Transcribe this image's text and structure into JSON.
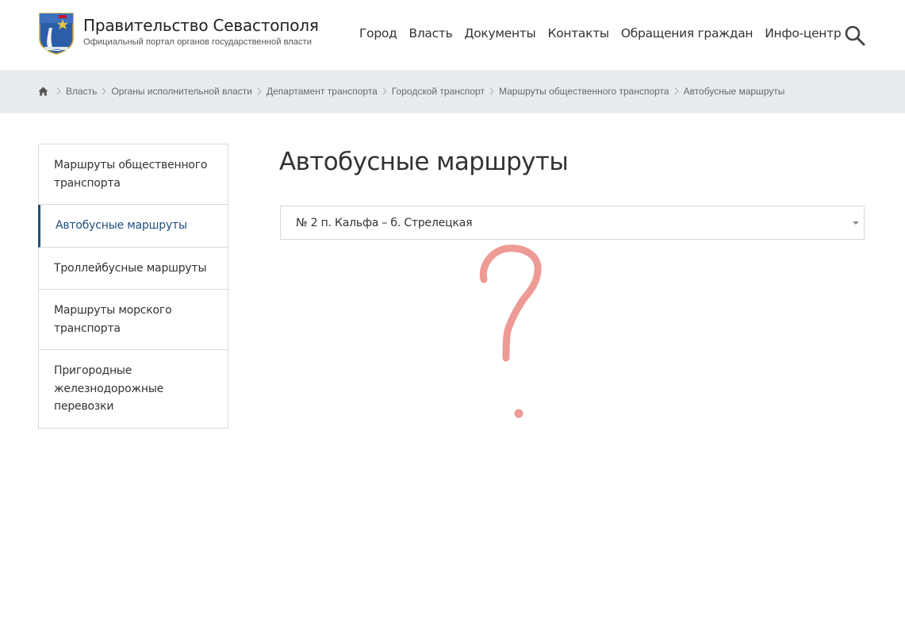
{
  "header": {
    "title": "Правительство Севастополя",
    "subtitle": "Официальный портал органов государственной власти",
    "nav": [
      {
        "label": "Город"
      },
      {
        "label": "Власть"
      },
      {
        "label": "Документы"
      },
      {
        "label": "Контакты"
      },
      {
        "label": "Обращения граждан"
      },
      {
        "label": "Инфо-центр"
      }
    ],
    "search_icon": "search-icon",
    "logo_icon": "coat-of-arms-icon"
  },
  "breadcrumb": {
    "home_icon": "home-icon",
    "items": [
      {
        "label": "Власть"
      },
      {
        "label": "Органы исполнительной власти"
      },
      {
        "label": "Департамент транспорта"
      },
      {
        "label": "Городской транспорт"
      },
      {
        "label": "Маршруты общественного транспорта"
      },
      {
        "label": "Автобусные маршруты"
      }
    ]
  },
  "sidebar": {
    "items": [
      {
        "label": "Маршруты общественного транспорта",
        "active": false
      },
      {
        "label": "Автобусные маршруты",
        "active": true
      },
      {
        "label": "Троллейбусные маршруты",
        "active": false
      },
      {
        "label": "Маршруты морского транспорта",
        "active": false
      },
      {
        "label": "Пригородные железнодорожные перевозки",
        "active": false
      }
    ]
  },
  "main": {
    "title": "Автобусные маршруты",
    "route_select": {
      "value": "№ 2 п. Кальфа – б. Стрелецкая",
      "icon": "chevron-down-icon"
    },
    "annotation": "question-mark-doodle"
  },
  "colors": {
    "accent": "#1f4e7c",
    "breadcrumb_bg": "#e8ecef",
    "border": "#d9d9d9",
    "doodle": "#ee9a95"
  }
}
